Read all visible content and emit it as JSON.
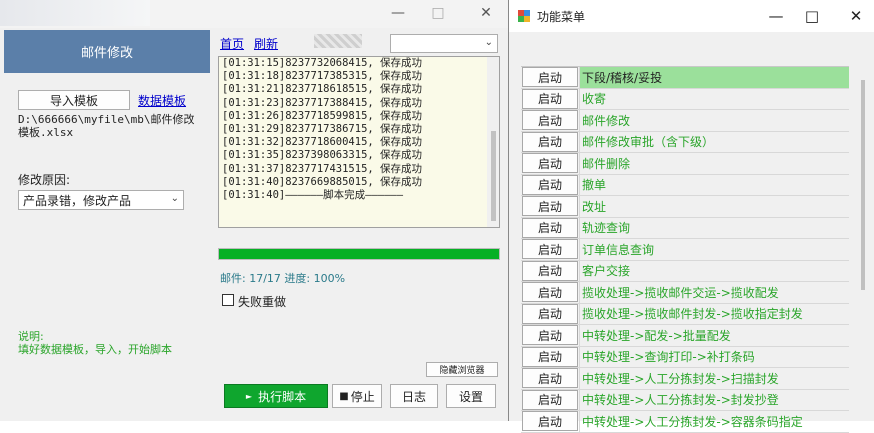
{
  "left_window": {
    "controls": {
      "minimize": "—",
      "maximize": "□",
      "close": "✕"
    },
    "header_title": "邮件修改",
    "import_button": "导入模板",
    "data_template_link": "数据模板",
    "file_path": "D:\\666666\\myfile\\mb\\邮件修改模板.xlsx",
    "reason_label": "修改原因:",
    "reason_value": "产品录错，修改产品",
    "note": "说明:\n填好数据模板，导入，开始脚本",
    "nav": {
      "home": "首页",
      "refresh": "刷新"
    },
    "top_select_value": "",
    "log": [
      "[01:31:15]8237732068415, 保存成功",
      "[01:31:18]8237717385315, 保存成功",
      "[01:31:21]8237718618515, 保存成功",
      "[01:31:23]8237717388415, 保存成功",
      "[01:31:26]8237718599815, 保存成功",
      "[01:31:29]8237717386715, 保存成功",
      "[01:31:32]8237718600415, 保存成功",
      "[01:31:35]8237398063315, 保存成功",
      "[01:31:37]8237717431515, 保存成功",
      "[01:31:40]8237669885015, 保存成功",
      "[01:31:40]——————脚本完成——————"
    ],
    "progress_percent": 100,
    "stats": "邮件: 17/17 进度: 100%",
    "retry_label": "失败重做",
    "retry_checked": false,
    "hide_browser_button": "隐藏浏览器",
    "run_button": "执行脚本",
    "stop_button": "停止",
    "log_button": "日志",
    "settings_button": "设置"
  },
  "right_window": {
    "title": "功能菜单",
    "controls": {
      "minimize": "—",
      "maximize": "□",
      "close": "✕"
    },
    "start_label": "启动",
    "items": [
      "下段/稽核/妥投",
      "收寄",
      "邮件修改",
      "邮件修改审批（含下级）",
      "邮件删除",
      "撤单",
      "改址",
      "轨迹查询",
      "订单信息查询",
      "客户交接",
      "揽收处理->揽收邮件交运->揽收配发",
      "揽收处理->揽收邮件封发->揽收指定封发",
      "中转处理->配发->批量配发",
      "中转处理->查询打印->补打条码",
      "中转处理->人工分拣封发->扫描封发",
      "中转处理->人工分拣封发->封发抄登",
      "中转处理->人工分拣封发->容器条码指定"
    ],
    "selected_index": 0
  }
}
